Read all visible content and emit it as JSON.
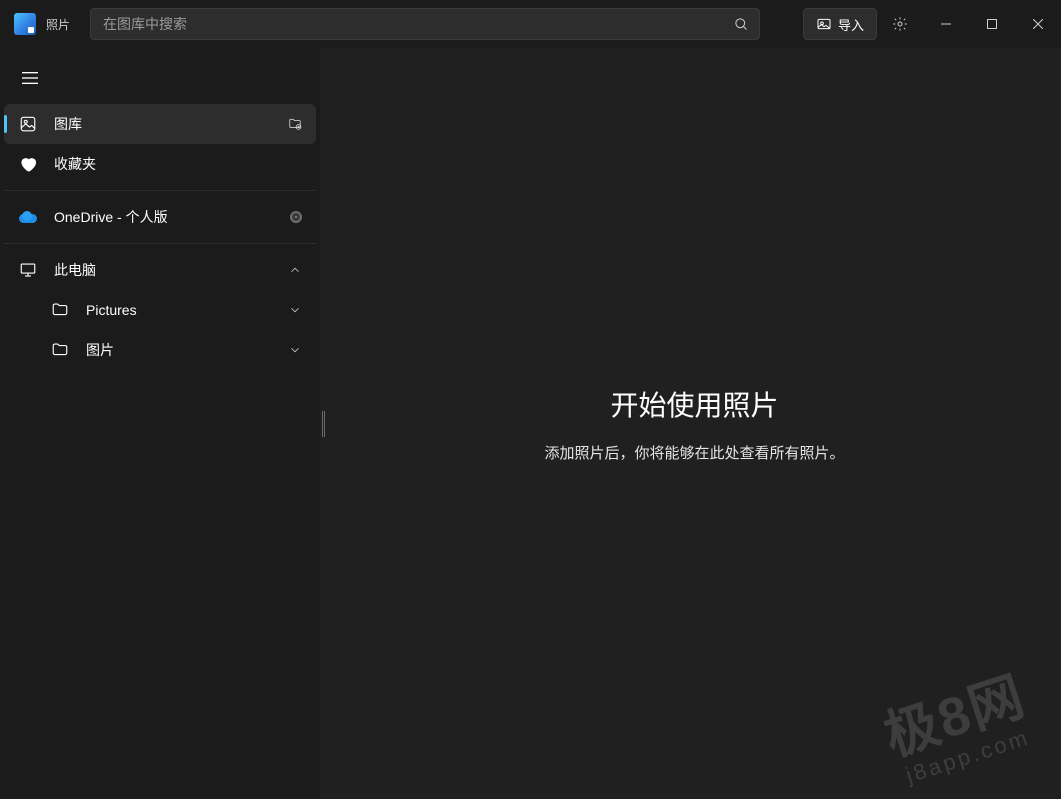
{
  "app": {
    "title": "照片"
  },
  "search": {
    "placeholder": "在图库中搜索"
  },
  "toolbar": {
    "import_label": "导入"
  },
  "sidebar": {
    "gallery": "图库",
    "favorites": "收藏夹",
    "onedrive": "OneDrive - 个人版",
    "this_pc": "此电脑",
    "folders": {
      "pictures": "Pictures",
      "tupian": "图片"
    }
  },
  "main": {
    "empty_title": "开始使用照片",
    "empty_subtitle": "添加照片后，你将能够在此处查看所有照片。"
  },
  "watermark": {
    "line1": "极8网",
    "line2": "j8app.com"
  }
}
